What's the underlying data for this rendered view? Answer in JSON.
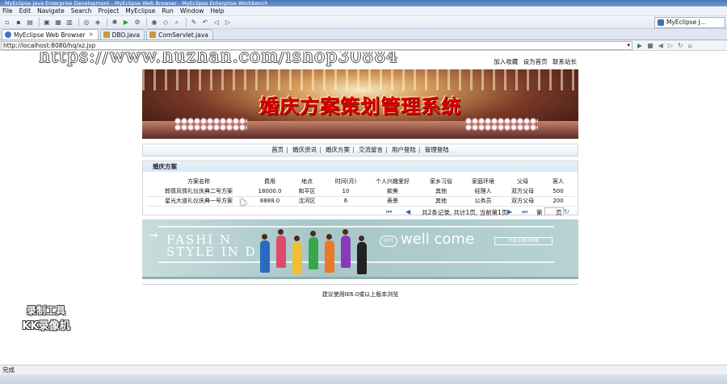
{
  "window": {
    "title": "MyEclipse Java Enterprise Development - MyEclipse Web Browser - MyEclipse Enterprise Workbench"
  },
  "menu": [
    "File",
    "Edit",
    "Navigate",
    "Search",
    "Project",
    "MyEclipse",
    "Run",
    "Window",
    "Help"
  ],
  "perspective": {
    "label": "MyEclipse J..."
  },
  "tabs": [
    {
      "label": "MyEclipse Web Browser",
      "active": true
    },
    {
      "label": "DBO.java",
      "active": false
    },
    {
      "label": "ComServlet.java",
      "active": false
    }
  ],
  "address": {
    "url": "http://localhost:8080/hq/xz.jsp"
  },
  "watermark": "https://www.huzhan.com/ishop30884",
  "page": {
    "top_links": [
      "加入收藏",
      "设为首页",
      "联系站长"
    ],
    "banner_title": "婚庆方案策划管理系统",
    "nav": [
      "首页",
      "婚庆资讯",
      "婚庆方案",
      "交流留言",
      "用户登陆",
      "管理登陆"
    ],
    "panel_title": "婚庆方案",
    "table": {
      "headers": [
        "方案名称",
        "费用",
        "地点",
        "时间(月)",
        "个人兴趣爱好",
        "家乡习俗",
        "家庭环境",
        "父母",
        "客人"
      ],
      "rows": [
        [
          "郎情风情礼仪庆典二号方案",
          "18000.0",
          "和平区",
          "10",
          "款美",
          "其他",
          "经理人",
          "双方父母",
          "500"
        ],
        [
          "星光大道礼仪庆典一号方案",
          "8888.0",
          "沈河区",
          "6",
          "表景",
          "其他",
          "公务员",
          "双方父母",
          "200"
        ]
      ]
    },
    "pager": {
      "info": "共2条记录, 共计1页, 当前第1页",
      "goto_prefix": "第",
      "goto_suffix": "页"
    },
    "promo": {
      "fashion_line1": "FASHI  N",
      "fashion_line2": "STYLE IN      D",
      "hot": "HOT",
      "welcome": "well come",
      "sub": "时尚主题冲陆客"
    },
    "footer": "建议使用IE6.0或以上版本浏览"
  },
  "overlay": {
    "line1": "录制工具",
    "line2": "KK录像机"
  },
  "status": "完成"
}
